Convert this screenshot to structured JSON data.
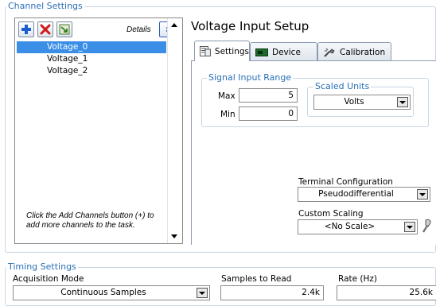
{
  "channel_settings": {
    "legend": "Channel Settings",
    "details_label": "Details",
    "details_button": "»",
    "channels": [
      "Voltage_0",
      "Voltage_1",
      "Voltage_2"
    ],
    "selected_index": 0,
    "hint": "Click the Add Channels button (+) to add more channels to the task.",
    "toolbar": {
      "add_icon": "plus-icon",
      "remove_icon": "x-icon",
      "rename_icon": "rename-channel-icon"
    }
  },
  "setup": {
    "title": "Voltage Input Setup",
    "tabs": [
      {
        "label": "Settings",
        "icon": "settings-icon"
      },
      {
        "label": "Device",
        "icon": "device-icon"
      },
      {
        "label": "Calibration",
        "icon": "calibration-icon"
      }
    ],
    "active_tab": "Settings",
    "signal_input_range": {
      "legend": "Signal Input Range",
      "max_label": "Max",
      "max_value": "5",
      "min_label": "Min",
      "min_value": "0"
    },
    "scaled_units": {
      "legend": "Scaled Units",
      "value": "Volts"
    },
    "terminal_configuration": {
      "label": "Terminal Configuration",
      "value": "Pseudodifferential"
    },
    "custom_scaling": {
      "label": "Custom Scaling",
      "value": "<No Scale>",
      "icon": "scale-wizard-icon"
    }
  },
  "timing_settings": {
    "legend": "Timing Settings",
    "acquisition_mode_label": "Acquisition Mode",
    "acquisition_mode_value": "Continuous Samples",
    "samples_to_read_label": "Samples to Read",
    "samples_to_read_value": "2.4k",
    "rate_label": "Rate (Hz)",
    "rate_value": "25.6k"
  },
  "colors": {
    "legend_text": "#2a6fb8",
    "selection": "#3a8ee6",
    "add_icon": "#1a5fd0",
    "remove_icon": "#d01818"
  }
}
